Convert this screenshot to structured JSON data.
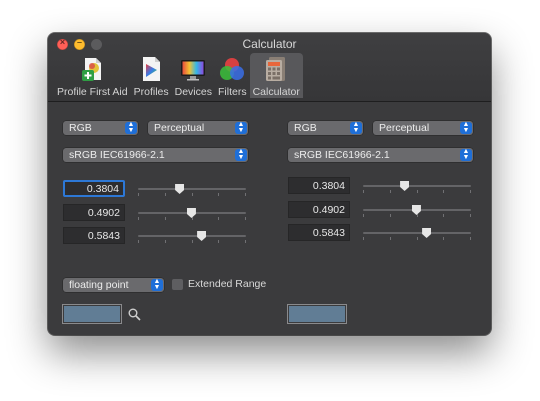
{
  "window": {
    "title": "Calculator"
  },
  "toolbar": {
    "items": [
      {
        "label": "Profile First Aid",
        "icon": "first-aid-icon"
      },
      {
        "label": "Profiles",
        "icon": "profiles-icon"
      },
      {
        "label": "Devices",
        "icon": "devices-icon"
      },
      {
        "label": "Filters",
        "icon": "filters-icon"
      },
      {
        "label": "Calculator",
        "icon": "calculator-icon",
        "active": true
      }
    ]
  },
  "left": {
    "color_space": "RGB",
    "intent": "Perceptual",
    "profile": "sRGB IEC61966-2.1",
    "channels": [
      {
        "value": "0.3804",
        "fraction": 0.3804
      },
      {
        "value": "0.4902",
        "fraction": 0.4902
      },
      {
        "value": "0.5843",
        "fraction": 0.5843
      }
    ],
    "number_format": "floating point",
    "extended_range_label": "Extended Range",
    "swatch_color": "#617d95"
  },
  "right": {
    "color_space": "RGB",
    "intent": "Perceptual",
    "profile": "sRGB IEC61966-2.1",
    "channels": [
      {
        "value": "0.3804",
        "fraction": 0.3804
      },
      {
        "value": "0.4902",
        "fraction": 0.4902
      },
      {
        "value": "0.5843",
        "fraction": 0.5843
      }
    ],
    "swatch_color": "#617d95"
  },
  "colors": {
    "accent": "#1f6fd8",
    "focus_ring": "#2d78d6"
  }
}
